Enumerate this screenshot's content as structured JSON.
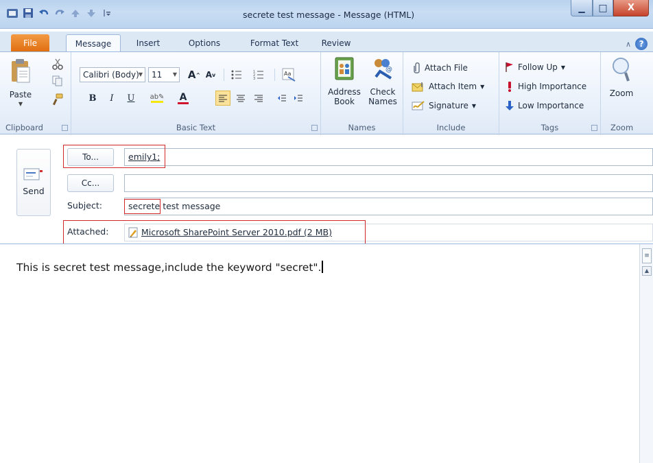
{
  "window": {
    "title": "secrete test message  -  Message (HTML)",
    "minimize_glyph": "▁",
    "maximize_glyph": "□",
    "close_glyph": "X"
  },
  "tabs": {
    "file": "File",
    "items": [
      "Message",
      "Insert",
      "Options",
      "Format Text",
      "Review"
    ],
    "active": "Message",
    "collapse_glyph": "∧",
    "help_glyph": "?"
  },
  "ribbon": {
    "clipboard": {
      "label": "Clipboard",
      "paste": "Paste"
    },
    "basic_text": {
      "label": "Basic Text",
      "font_name": "Calibri (Body)",
      "font_size": "11",
      "bold": "B",
      "italic": "I",
      "underline": "U",
      "grow_font": "A",
      "shrink_font": "A",
      "font_color": "A"
    },
    "names": {
      "label": "Names",
      "address_book": [
        "Address",
        "Book"
      ],
      "check_names": [
        "Check",
        "Names"
      ]
    },
    "include": {
      "label": "Include",
      "attach_file": "Attach File",
      "attach_item": "Attach Item",
      "signature": "Signature"
    },
    "tags": {
      "label": "Tags",
      "follow_up": "Follow Up",
      "high_importance": "High Importance",
      "low_importance": "Low Importance"
    },
    "zoom": {
      "label": "Zoom",
      "button": "Zoom"
    }
  },
  "message": {
    "send": "Send",
    "to_button": "To...",
    "cc_button": "Cc...",
    "to_value": "emily1;",
    "cc_value": "",
    "subject_label": "Subject:",
    "subject_highlight": "secrete",
    "subject_rest": " test message",
    "attached_label": "Attached:",
    "attachment_name": "Microsoft SharePoint Server 2010.pdf (2 MB)",
    "body": "This is secret test message,include the keyword \"secret\"."
  },
  "colors": {
    "highlight_box": "#d32626",
    "file_tab": "#e06d10",
    "font_color_bar": "#d0142d",
    "highlight_bar": "#f5e60c",
    "flag_red": "#c8102e",
    "low_importance_blue": "#2a62c8"
  },
  "icons": [
    "save-icon",
    "undo-icon",
    "redo-icon",
    "up-arrow-icon",
    "down-arrow-icon",
    "paste-icon",
    "cut-icon",
    "copy-icon",
    "format-painter-icon",
    "address-book-icon",
    "check-names-icon",
    "paperclip-icon",
    "attach-item-icon",
    "signature-icon",
    "flag-icon",
    "high-importance-icon",
    "low-importance-icon",
    "zoom-icon",
    "send-icon",
    "pdf-attachment-icon"
  ]
}
